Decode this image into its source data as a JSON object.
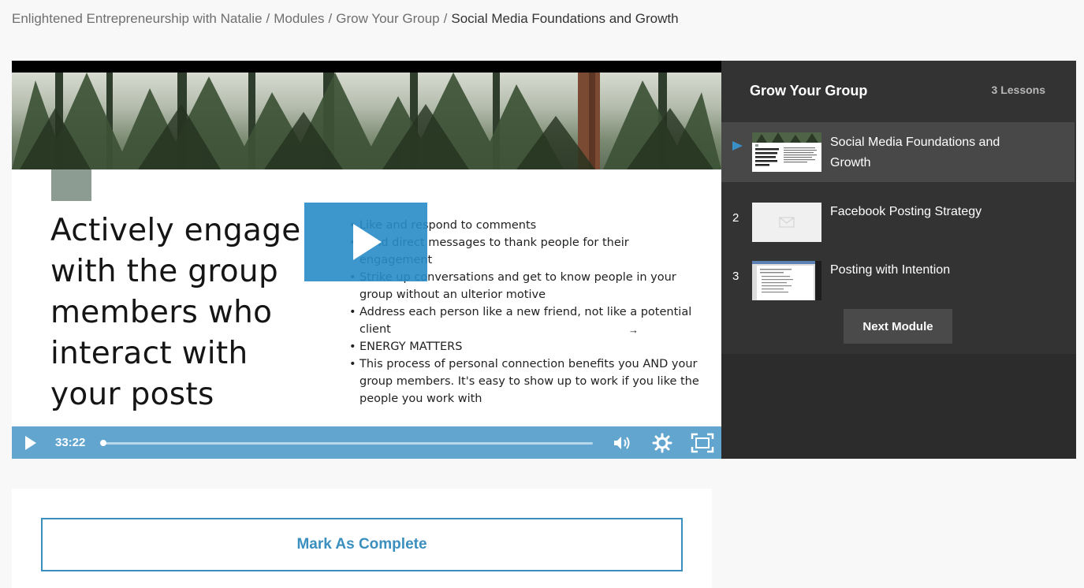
{
  "breadcrumb": {
    "items": [
      "Enlightened Entrepreneurship with Natalie",
      "Modules",
      "Grow Your Group"
    ],
    "current": "Social Media Foundations and Growth",
    "separator": "/"
  },
  "video": {
    "headline": "Actively engage with the group members who interact with your posts",
    "bullets": [
      "Like and respond to comments",
      "Send direct messages to thank people for their engagement",
      "Strike up conversations and get to know people in your group without an ulterior motive",
      "Address each person like a new friend, not like a potential client",
      "ENERGY MATTERS",
      "This process of personal connection benefits you AND your group members. It's easy to show up to work if you like the people you work with"
    ],
    "time": "33:22",
    "progress": 0.003,
    "accent": "#3a8fc4"
  },
  "sidebar": {
    "title": "Grow Your Group",
    "count": "3 Lessons",
    "lessons": [
      {
        "num": "",
        "title": "Social Media Foundations and Growth",
        "active": true
      },
      {
        "num": "2",
        "title": "Facebook Posting Strategy",
        "active": false
      },
      {
        "num": "3",
        "title": "Posting with Intention",
        "active": false
      }
    ],
    "next_label": "Next Module"
  },
  "complete": {
    "label": "Mark As Complete"
  }
}
